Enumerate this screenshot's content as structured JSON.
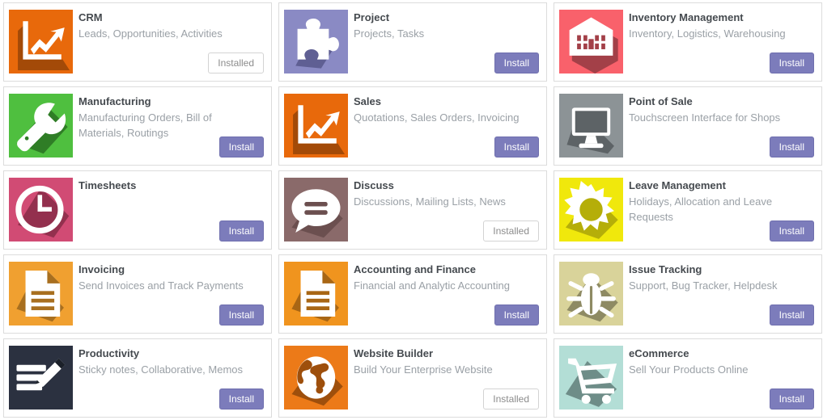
{
  "buttons": {
    "install_label": "Install",
    "installed_label": "Installed"
  },
  "colors": {
    "install_button": "#7c7cbb",
    "installed_text": "#8c8c8c",
    "title": "#454a4f",
    "description": "#9aa0a6",
    "card_border": "#dcdcdc"
  },
  "apps": [
    {
      "name": "CRM",
      "description": "Leads, Opportunities, Activities",
      "status": "Installed",
      "installed": true,
      "icon": "growth-chart-icon",
      "icon_bg": "#e8690b",
      "icon_shadow": "#a34a08",
      "icon_fg": "#ffffff"
    },
    {
      "name": "Project",
      "description": "Projects, Tasks",
      "status": "Install",
      "installed": false,
      "icon": "puzzle-piece-icon",
      "icon_bg": "#8a8ac4",
      "icon_shadow": "#5f5f93",
      "icon_fg": "#ffffff"
    },
    {
      "name": "Inventory Management",
      "description": "Inventory, Logistics, Warehousing",
      "status": "Install",
      "installed": false,
      "icon": "warehouse-icon",
      "icon_bg": "#f9616b",
      "icon_shadow": "#a34048",
      "icon_fg": "#ffffff"
    },
    {
      "name": "Manufacturing",
      "description": "Manufacturing Orders, Bill of Materials, Routings",
      "status": "Install",
      "installed": false,
      "icon": "wrench-icon",
      "icon_bg": "#4fbf3f",
      "icon_shadow": "#2f7d26",
      "icon_fg": "#ffffff"
    },
    {
      "name": "Sales",
      "description": "Quotations, Sales Orders, Invoicing",
      "status": "Install",
      "installed": false,
      "icon": "growth-chart-icon",
      "icon_bg": "#e8690b",
      "icon_shadow": "#a34a08",
      "icon_fg": "#ffffff"
    },
    {
      "name": "Point of Sale",
      "description": "Touchscreen Interface for Shops",
      "status": "Install",
      "installed": false,
      "icon": "monitor-icon",
      "icon_bg": "#8c9396",
      "icon_shadow": "#5d6366",
      "icon_fg": "#ffffff"
    },
    {
      "name": "Timesheets",
      "description": "",
      "status": "Install",
      "installed": false,
      "icon": "clock-icon",
      "icon_bg": "#d14b74",
      "icon_shadow": "#93304e",
      "icon_fg": "#ffffff"
    },
    {
      "name": "Discuss",
      "description": "Discussions, Mailing Lists, News",
      "status": "Installed",
      "installed": true,
      "icon": "speech-bubble-icon",
      "icon_bg": "#8a6a6a",
      "icon_shadow": "#6b4f4f",
      "icon_fg": "#ffffff"
    },
    {
      "name": "Leave Management",
      "description": "Holidays, Allocation and Leave Requests",
      "status": "Install",
      "installed": false,
      "icon": "sun-icon",
      "icon_bg": "#f0e80c",
      "icon_shadow": "#b5ae09",
      "icon_fg": "#ffffff"
    },
    {
      "name": "Invoicing",
      "description": "Send Invoices and Track Payments",
      "status": "Install",
      "installed": false,
      "icon": "document-icon",
      "icon_bg": "#f0a030",
      "icon_shadow": "#a86f1f",
      "icon_fg": "#ffffff"
    },
    {
      "name": "Accounting and Finance",
      "description": "Financial and Analytic Accounting",
      "status": "Install",
      "installed": false,
      "icon": "document-icon",
      "icon_bg": "#f0941e",
      "icon_shadow": "#a86614",
      "icon_fg": "#ffffff"
    },
    {
      "name": "Issue Tracking",
      "description": "Support, Bug Tracker, Helpdesk",
      "status": "Install",
      "installed": false,
      "icon": "bug-icon",
      "icon_bg": "#d9d39a",
      "icon_shadow": "#8e8a63",
      "icon_fg": "#ffffff"
    },
    {
      "name": "Productivity",
      "description": "Sticky notes, Collaborative, Memos",
      "status": "Install",
      "installed": false,
      "icon": "notes-pencil-icon",
      "icon_bg": "#2b3140",
      "icon_shadow": "#1b2029",
      "icon_fg": "#ffffff"
    },
    {
      "name": "Website Builder",
      "description": "Build Your Enterprise Website",
      "status": "Installed",
      "installed": true,
      "icon": "globe-icon",
      "icon_bg": "#ec7a18",
      "icon_shadow": "#9e4f0c",
      "icon_fg": "#ffffff"
    },
    {
      "name": "eCommerce",
      "description": "Sell Your Products Online",
      "status": "Install",
      "installed": false,
      "icon": "shopping-cart-icon",
      "icon_bg": "#b3ded6",
      "icon_shadow": "#6e8d88",
      "icon_fg": "#ffffff"
    }
  ]
}
